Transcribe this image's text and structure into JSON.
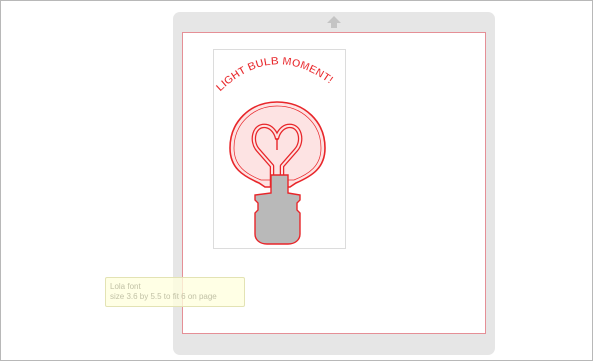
{
  "design": {
    "arc_text": "LIGHT BULB MOMENT!",
    "text_color": "#e8262a",
    "outline_color": "#e8262a",
    "bulb_fill": "#fde3e3",
    "base_fill": "#b9b9b9"
  },
  "tooltip": {
    "line1": "Lola font",
    "line2": "size 3.6 by 5.5 to fit 6 on page"
  },
  "colors": {
    "mat_border": "#e58f96",
    "frame": "#e6e6e6",
    "tooltip_bg": "#ffffde"
  },
  "icons": {
    "up": "up-arrow-icon"
  }
}
